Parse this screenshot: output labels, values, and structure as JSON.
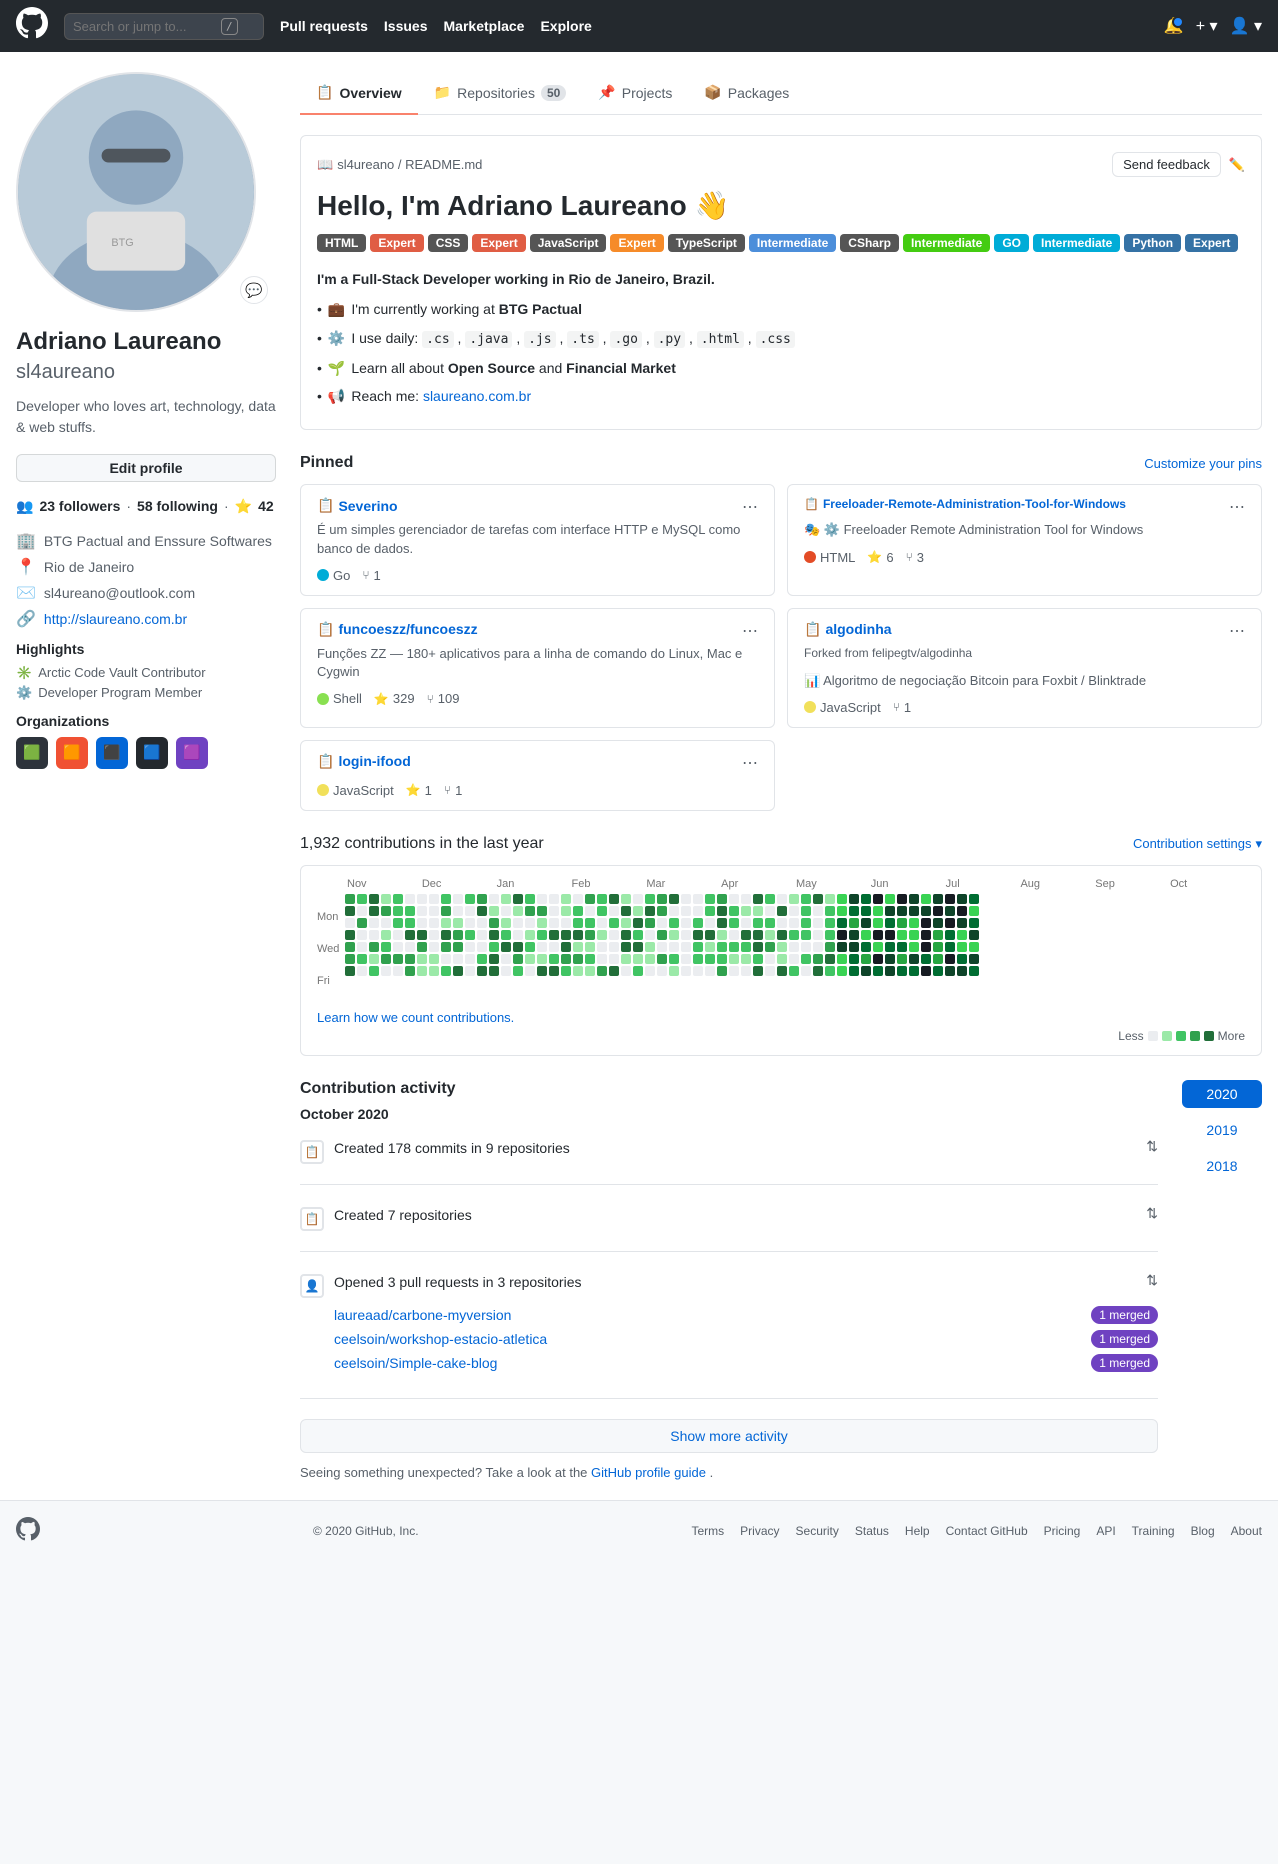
{
  "header": {
    "logo": "⬤",
    "search_placeholder": "Search or jump to...",
    "search_shortcut": "/",
    "nav": [
      "Pull requests",
      "Issues",
      "Marketplace",
      "Explore"
    ],
    "notification_icon": "🔔",
    "plus_icon": "+",
    "user_avatar": "👤"
  },
  "profile": {
    "name": "Adriano Laureano",
    "username": "sl4aureano",
    "bio": "Developer who loves art, technology, data & web stuffs.",
    "edit_btn": "Edit profile",
    "followers": "23",
    "following": "58",
    "stars": "42",
    "company": "BTG Pactual and Enssure Softwares",
    "location": "Rio de Janeiro",
    "email": "sl4ureano@outlook.com",
    "website": "http://slaureano.com.br",
    "highlights_title": "Highlights",
    "highlights": [
      "Arctic Code Vault Contributor",
      "Developer Program Member"
    ],
    "orgs_title": "Organizations",
    "orgs": [
      "🟩",
      "🟧",
      "🔵",
      "🟦",
      "🟪"
    ]
  },
  "tabs": [
    {
      "label": "Overview",
      "active": true,
      "count": null
    },
    {
      "label": "Repositories",
      "active": false,
      "count": "50"
    },
    {
      "label": "Projects",
      "active": false,
      "count": null
    },
    {
      "label": "Packages",
      "active": false,
      "count": null
    }
  ],
  "readme": {
    "path": "sl4ureano / README.md",
    "send_feedback": "Send feedback",
    "title": "Hello, I'm Adriano Laureano 👋",
    "badges": [
      {
        "label": "HTML",
        "value": "Expert",
        "label_color": "#555",
        "value_color": "#e05d44"
      },
      {
        "label": "CSS",
        "value": "Expert",
        "label_color": "#555",
        "value_color": "#e05d44"
      },
      {
        "label": "JavaScript",
        "value": "Expert",
        "label_color": "#555",
        "value_color": "#f68b29"
      },
      {
        "label": "TypeScript",
        "value": "Intermediate",
        "label_color": "#555",
        "value_color": "#4c8eda"
      },
      {
        "label": "CSharp",
        "value": "Intermediate",
        "label_color": "#555",
        "value_color": "#44cc11"
      },
      {
        "label": "GO",
        "value": "Intermediate",
        "label_color": "#555",
        "value_color": "#00acd7"
      },
      {
        "label": "Python",
        "value": "Expert",
        "label_color": "#555",
        "value_color": "#3572A5"
      }
    ],
    "intro": "I'm a Full-Stack Developer working in Rio de Janeiro, Brazil.",
    "bullets": [
      {
        "icon": "💼",
        "text": "I'm currently working at BTG Pactual"
      },
      {
        "icon": "⚙️",
        "text": "I use daily: .cs , .java , .js , .ts , .go , .py , .html , .css"
      },
      {
        "icon": "🌱",
        "text": "Learn all about Open Source and Financial Market"
      },
      {
        "icon": "📢",
        "text": "Reach me: slaureano.com.br"
      }
    ]
  },
  "pinned": {
    "title": "Pinned",
    "customize_link": "Customize your pins",
    "repos": [
      {
        "name": "Severino",
        "icon": "📋",
        "desc": "É um simples gerenciador de tarefas com interface HTTP e MySQL como banco de dados.",
        "lang": "Go",
        "lang_class": "lang-go",
        "stars": null,
        "forks": "1"
      },
      {
        "name": "Freeloader-Remote-Administration-Tool-for-Windows",
        "icon": "📋",
        "desc": "Freeloader Remote Administration Tool for Windows",
        "lang": "HTML",
        "lang_class": "lang-html",
        "stars": "6",
        "forks": "3"
      },
      {
        "name": "funcoeszz/funcoeszz",
        "icon": "📋",
        "desc": "Funções ZZ — 180+ aplicativos para a linha de comando do Linux, Mac e Cygwin",
        "lang": "Shell",
        "lang_class": "lang-shell",
        "stars": "329",
        "forks": "109"
      },
      {
        "name": "algodinha",
        "icon": "📋",
        "forked": "Forked from felipegtv/algodinha",
        "desc": "Algoritmo de negociação Bitcoin para Foxbit / Blinktrade",
        "lang": "JavaScript",
        "lang_class": "lang-js",
        "stars": null,
        "forks": "1"
      },
      {
        "name": "login-ifood",
        "icon": "📋",
        "desc": null,
        "lang": "JavaScript",
        "lang_class": "lang-js",
        "stars": "1",
        "forks": "1"
      }
    ]
  },
  "contributions": {
    "title": "1,932 contributions in the last year",
    "settings_label": "Contribution settings",
    "month_labels": [
      "Nov",
      "Dec",
      "Jan",
      "Feb",
      "Mar",
      "Apr",
      "May",
      "Jun",
      "Jul",
      "Aug",
      "Sep",
      "Oct"
    ],
    "day_labels": [
      "Mon",
      "Wed",
      "Fri"
    ],
    "legend": [
      "Less",
      "More"
    ],
    "learn_link": "Learn how we count contributions."
  },
  "activity": {
    "title": "Contribution activity",
    "period": "October 2020",
    "years": [
      "2020",
      "2019",
      "2018"
    ],
    "active_year": "2020",
    "items": [
      {
        "icon": "📋",
        "text": "Created 178 commits in 9 repositories",
        "expand": true
      },
      {
        "icon": "📋",
        "text": "Created 7 repositories",
        "expand": true
      },
      {
        "icon": "👤",
        "text": "Opened 3 pull requests in 3 repositories",
        "expand": true,
        "prs": [
          {
            "link": "laureaad/carbone-myversion",
            "badge": "1 merged"
          },
          {
            "link": "ceelsoin/workshop-estacio-atletica",
            "badge": "1 merged"
          },
          {
            "link": "ceelsoin/Simple-cake-blog",
            "badge": "1 merged"
          }
        ]
      }
    ],
    "show_more": "Show more activity",
    "note": "Seeing something unexpected? Take a look at the",
    "note_link": "GitHub profile guide",
    "note_suffix": "."
  },
  "footer": {
    "copy": "© 2020 GitHub, Inc.",
    "links": [
      "Terms",
      "Privacy",
      "Security",
      "Status",
      "Help",
      "Contact GitHub",
      "Pricing",
      "API",
      "Training",
      "Blog",
      "About"
    ]
  }
}
